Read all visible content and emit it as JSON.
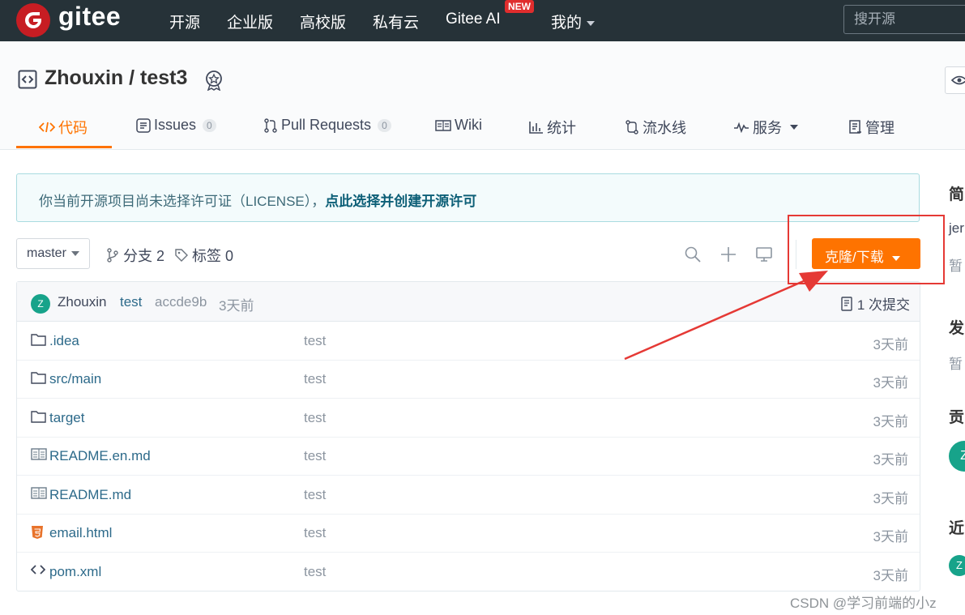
{
  "topbar": {
    "logo_text": "gitee",
    "nav": [
      "开源",
      "企业版",
      "高校版",
      "私有云",
      "Gitee AI",
      "我的"
    ],
    "new_badge": "NEW",
    "search_placeholder": "搜开源"
  },
  "repo": {
    "title": "Zhouxin / test3"
  },
  "tabs": [
    {
      "label": "代码"
    },
    {
      "label": "Issues",
      "count": "0"
    },
    {
      "label": "Pull Requests",
      "count": "0"
    },
    {
      "label": "Wiki"
    },
    {
      "label": "统计"
    },
    {
      "label": "流水线"
    },
    {
      "label": "服务"
    },
    {
      "label": "管理"
    }
  ],
  "notice": {
    "text": "你当前开源项目尚未选择许可证（LICENSE），",
    "link": "点此选择并创建开源许可"
  },
  "branch": {
    "current": "master",
    "branches": "分支 2",
    "tags": "标签 0",
    "clone_label": "克隆/下载"
  },
  "commit": {
    "avatar": "Z",
    "author": "Zhouxin",
    "message": "test",
    "hash": "accde9b",
    "time": "3天前",
    "count": "1 次提交"
  },
  "files": [
    {
      "name": ".idea",
      "type": "folder",
      "message": "test",
      "time": "3天前"
    },
    {
      "name": "src/main",
      "type": "folder",
      "message": "test",
      "time": "3天前"
    },
    {
      "name": "target",
      "type": "folder",
      "message": "test",
      "time": "3天前"
    },
    {
      "name": "README.en.md",
      "type": "readme",
      "message": "test",
      "time": "3天前"
    },
    {
      "name": "README.md",
      "type": "readme",
      "message": "test",
      "time": "3天前"
    },
    {
      "name": "email.html",
      "type": "html",
      "message": "test",
      "time": "3天前"
    },
    {
      "name": "pom.xml",
      "type": "code",
      "message": "test",
      "time": "3天前"
    }
  ],
  "sidebar": {
    "h1": "简",
    "t1": "jer",
    "t2": "暂",
    "h2": "发",
    "t3": "暂",
    "h3": "贡",
    "a1": "Z",
    "h4": "近",
    "a2": "Z"
  },
  "watermark": "CSDN @学习前端的小z",
  "colors": {
    "accent": "#fe7300",
    "topbar": "#263238",
    "brand": "#c71d23",
    "annotation": "#e53935"
  }
}
